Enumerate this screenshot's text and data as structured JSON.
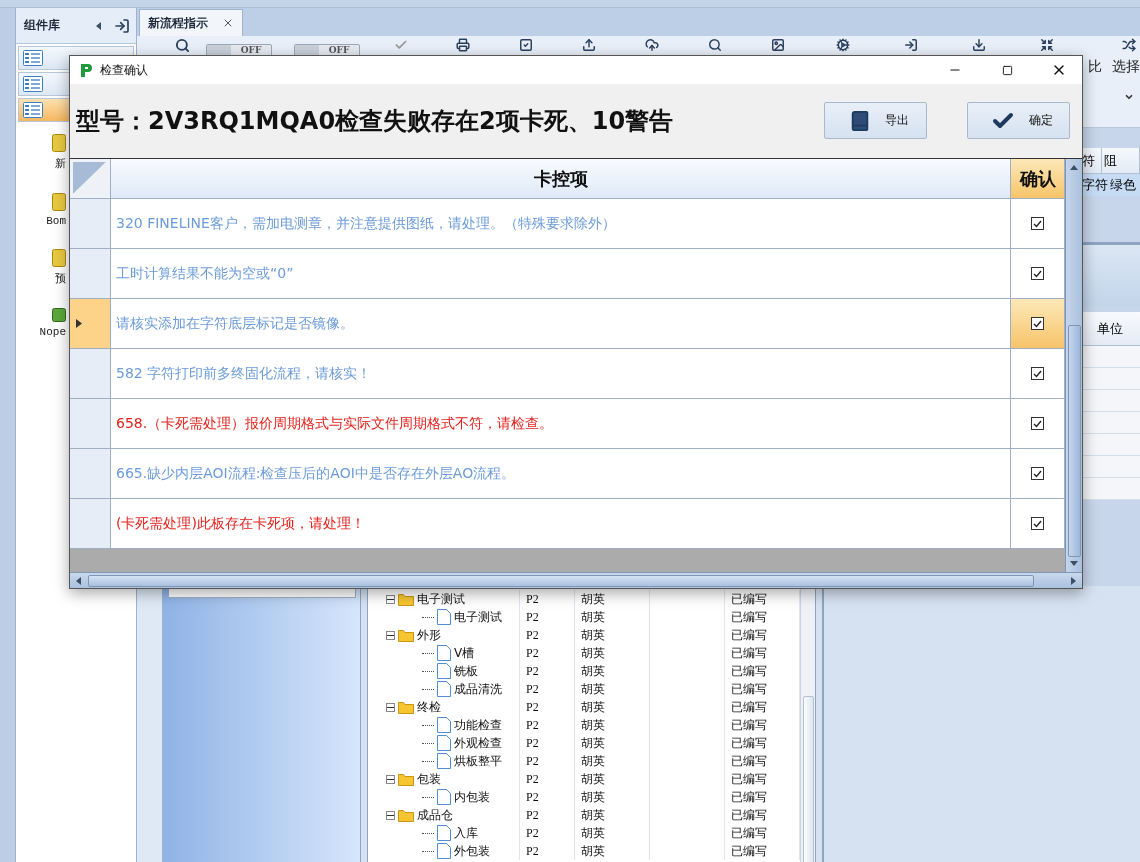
{
  "sidebar": {
    "title": "组件库",
    "items": [
      {
        "selected": false
      },
      {
        "selected": false
      },
      {
        "selected": true
      }
    ],
    "launchers": [
      {
        "label": "新",
        "kind": "folder"
      },
      {
        "label": "Bom",
        "kind": "folder"
      },
      {
        "label": "预",
        "kind": "folder"
      },
      {
        "label": "Nope",
        "kind": "leaf"
      }
    ]
  },
  "tab": {
    "label": "新流程指示"
  },
  "toolbar": {
    "toggles": [
      {
        "label": "OFF",
        "on": false
      },
      {
        "label": "OFF",
        "on": false
      }
    ],
    "labels": [
      "比",
      "选择"
    ]
  },
  "side_grid": {
    "columns": [
      "符",
      "阻"
    ],
    "row": [
      "字符",
      "绿色"
    ]
  },
  "lower_grid": {
    "columns": [
      "单位"
    ]
  },
  "process_tree": {
    "rows": [
      {
        "name": "电子测试",
        "kind": "folder",
        "expanded": true,
        "version": "P2",
        "owner": "胡英",
        "status": "已编写",
        "children": [
          {
            "name": "电子测试",
            "kind": "leaf",
            "version": "P2",
            "owner": "胡英",
            "status": "已编写"
          }
        ]
      },
      {
        "name": "外形",
        "kind": "folder",
        "expanded": true,
        "version": "P2",
        "owner": "胡英",
        "status": "已编写",
        "children": [
          {
            "name": "V槽",
            "kind": "leaf",
            "version": "P2",
            "owner": "胡英",
            "status": "已编写"
          },
          {
            "name": "铣板",
            "kind": "leaf",
            "version": "P2",
            "owner": "胡英",
            "status": "已编写"
          },
          {
            "name": "成品清洗",
            "kind": "leaf",
            "version": "P2",
            "owner": "胡英",
            "status": "已编写"
          }
        ]
      },
      {
        "name": "终检",
        "kind": "folder",
        "expanded": true,
        "version": "P2",
        "owner": "胡英",
        "status": "已编写",
        "children": [
          {
            "name": "功能检查",
            "kind": "leaf",
            "version": "P2",
            "owner": "胡英",
            "status": "已编写"
          },
          {
            "name": "外观检查",
            "kind": "leaf",
            "version": "P2",
            "owner": "胡英",
            "status": "已编写"
          },
          {
            "name": "烘板整平",
            "kind": "leaf",
            "version": "P2",
            "owner": "胡英",
            "status": "已编写"
          }
        ]
      },
      {
        "name": "包装",
        "kind": "folder",
        "expanded": true,
        "version": "P2",
        "owner": "胡英",
        "status": "已编写",
        "children": [
          {
            "name": "内包装",
            "kind": "leaf",
            "version": "P2",
            "owner": "胡英",
            "status": "已编写"
          }
        ]
      },
      {
        "name": "成品仓",
        "kind": "folder",
        "expanded": true,
        "version": "P2",
        "owner": "胡英",
        "status": "已编写",
        "children": [
          {
            "name": "入库",
            "kind": "leaf",
            "version": "P2",
            "owner": "胡英",
            "status": "已编写"
          },
          {
            "name": "外包装",
            "kind": "leaf",
            "version": "P2",
            "owner": "胡英",
            "status": "已编写"
          }
        ]
      }
    ]
  },
  "dialog": {
    "title": "检查确认",
    "heading": "型号：2V3RQ1MQA0检查失败存在2项卡死、10警告",
    "buttons": [
      {
        "label": "导出",
        "kind": "export"
      },
      {
        "label": "确定",
        "kind": "confirm"
      }
    ],
    "columns": [
      "卡控项",
      "确认"
    ],
    "rows": [
      {
        "text": "320 FINELINE客户，需加电测章，并注意提供图纸，请处理。（特殊要求除外）",
        "kind": "warning",
        "checked": true,
        "selected": false
      },
      {
        "text": "工时计算结果不能为空或“0”",
        "kind": "warning",
        "checked": true,
        "selected": false
      },
      {
        "text": "请核实添加在字符底层标记是否镜像。",
        "kind": "warning",
        "checked": true,
        "selected": true
      },
      {
        "text": "582 字符打印前多终固化流程，请核实！",
        "kind": "warning",
        "checked": true,
        "selected": false
      },
      {
        "text": "658.（卡死需处理）报价周期格式与实际文件周期格式不符，请检查。",
        "kind": "blocking",
        "checked": true,
        "selected": false
      },
      {
        "text": "665.缺少内层AOI流程:检查压后的AOI中是否存在外层AO流程。",
        "kind": "warning",
        "checked": true,
        "selected": false
      },
      {
        "text": "(卡死需处理)此板存在卡死项，请处理！",
        "kind": "blocking",
        "checked": true,
        "selected": false
      }
    ]
  }
}
